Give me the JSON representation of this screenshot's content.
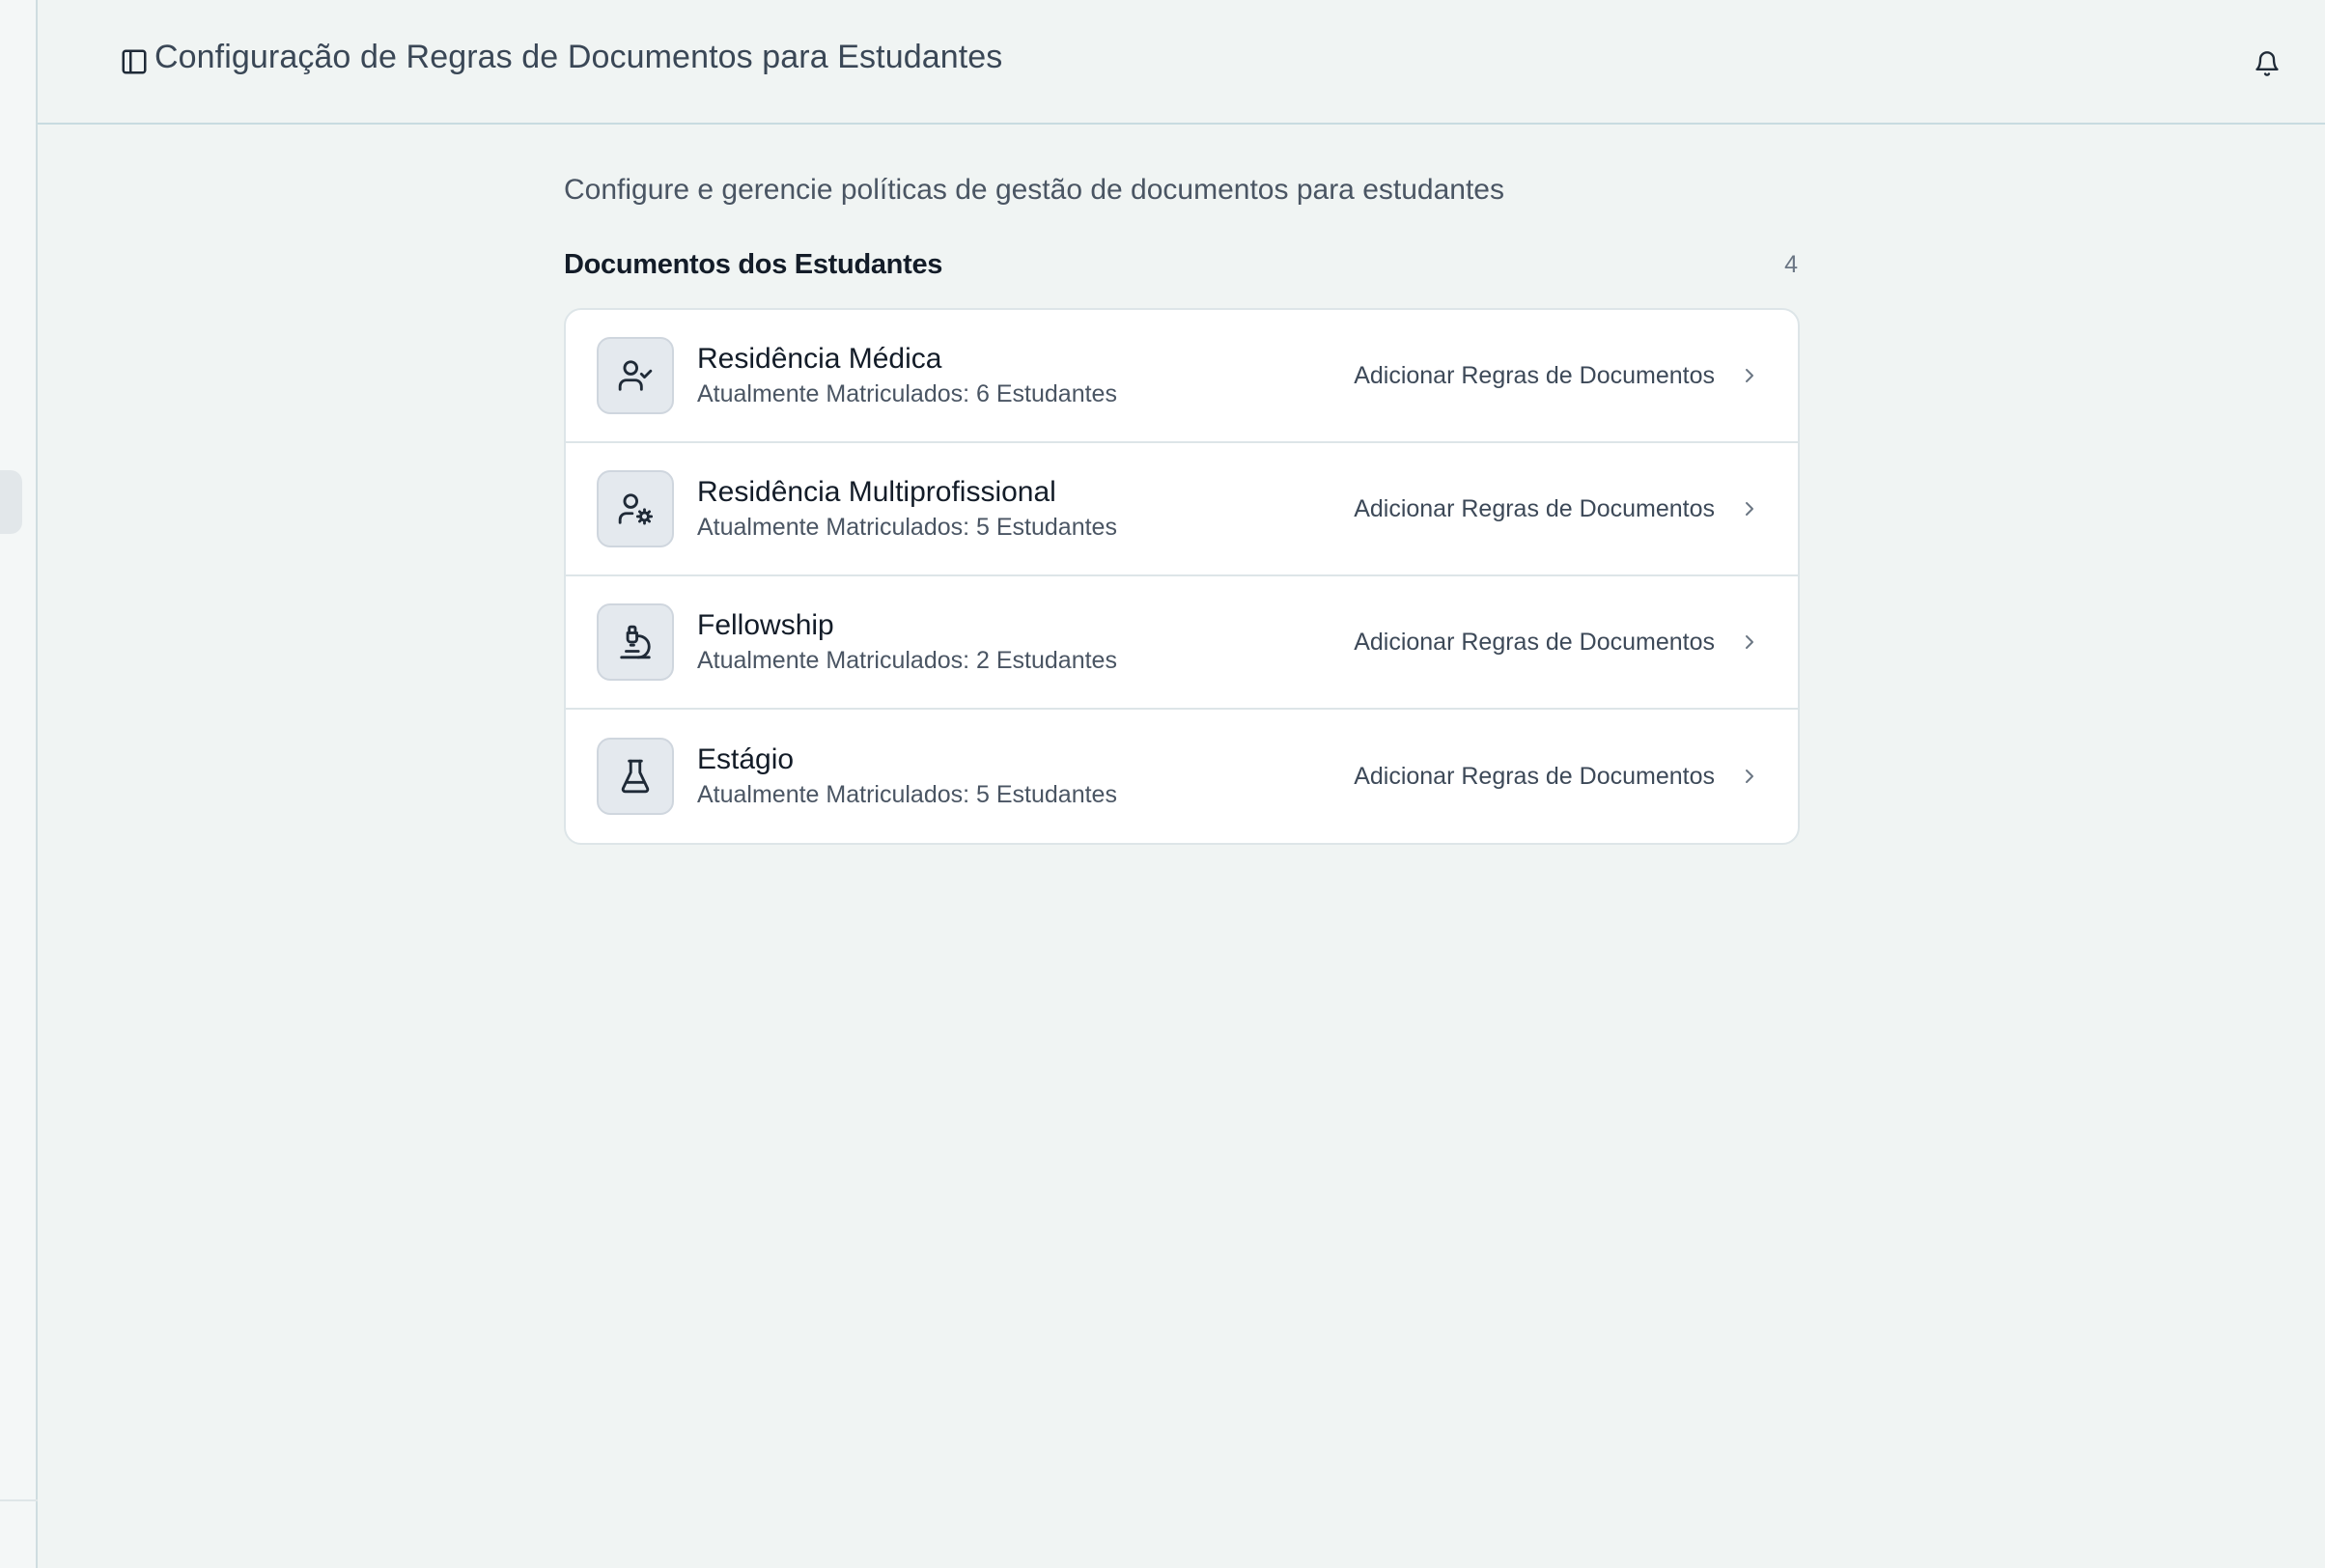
{
  "header": {
    "title": "Configuração de Regras de Documentos para Estudantes",
    "sidebar_toggle_icon": "sidebar-toggle-icon",
    "notification_icon": "bell-icon"
  },
  "main": {
    "description": "Configure e gerencie políticas de gestão de documentos para estudantes",
    "section_title": "Documentos dos Estudantes",
    "count": "4",
    "items": [
      {
        "title": "Residência Médica",
        "subtitle": "Atualmente Matriculados: 6 Estudantes",
        "action": "Adicionar Regras de Documentos",
        "icon": "user-check-icon"
      },
      {
        "title": "Residência Multiprofissional",
        "subtitle": "Atualmente Matriculados: 5 Estudantes",
        "action": "Adicionar Regras de Documentos",
        "icon": "user-cog-icon"
      },
      {
        "title": "Fellowship",
        "subtitle": "Atualmente Matriculados: 2 Estudantes",
        "action": "Adicionar Regras de Documentos",
        "icon": "microscope-icon"
      },
      {
        "title": "Estágio",
        "subtitle": "Atualmente Matriculados: 5 Estudantes",
        "action": "Adicionar Regras de Documentos",
        "icon": "flask-icon"
      }
    ]
  }
}
